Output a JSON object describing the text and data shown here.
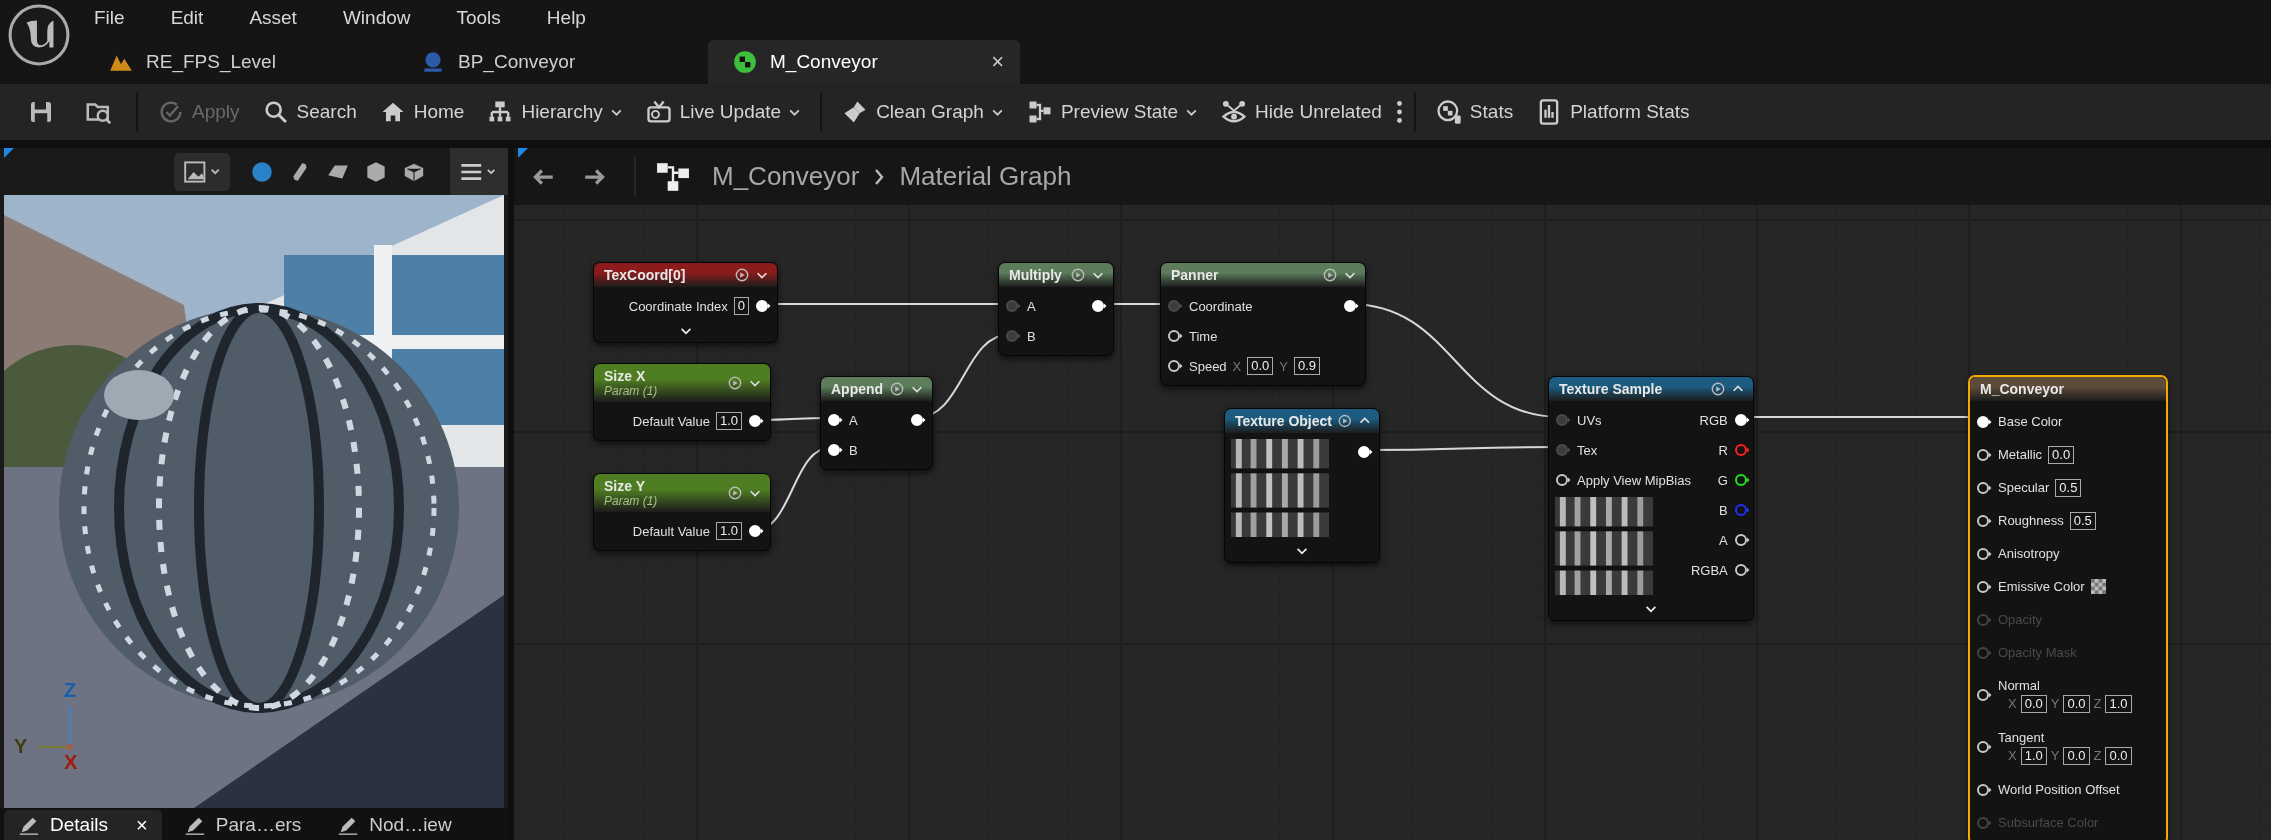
{
  "menu": [
    "File",
    "Edit",
    "Asset",
    "Window",
    "Tools",
    "Help"
  ],
  "document_tabs": [
    {
      "label": "RE_FPS_Level",
      "selected": false
    },
    {
      "label": "BP_Conveyor",
      "selected": false
    },
    {
      "label": "M_Conveyor",
      "selected": true,
      "close": "×"
    }
  ],
  "toolbar": [
    {
      "buttons": [
        {
          "kind": "icon"
        },
        {
          "kind": "icon"
        }
      ]
    },
    {
      "buttons": [
        {
          "kind": "text",
          "label": "Apply",
          "disabled": true,
          "dropdown": false
        },
        {
          "kind": "text",
          "label": "Search",
          "disabled": false,
          "dropdown": false
        },
        {
          "kind": "text",
          "label": "Home",
          "disabled": false,
          "dropdown": false
        },
        {
          "kind": "text",
          "label": "Hierarchy",
          "disabled": false,
          "dropdown": true
        },
        {
          "kind": "text",
          "label": "Live Update",
          "disabled": false,
          "dropdown": true
        }
      ]
    },
    {
      "buttons": [
        {
          "kind": "text",
          "label": "Clean Graph",
          "disabled": false,
          "dropdown": true
        },
        {
          "kind": "text",
          "label": "Preview State",
          "disabled": false,
          "dropdown": true
        },
        {
          "kind": "text",
          "label": "Hide Unrelated",
          "disabled": false,
          "dropdown": false
        },
        {
          "kind": "more"
        }
      ]
    },
    {
      "buttons": [
        {
          "kind": "text",
          "label": "Stats",
          "disabled": false,
          "dropdown": false
        },
        {
          "kind": "text",
          "label": "Platform Stats",
          "disabled": false,
          "dropdown": false
        }
      ]
    }
  ],
  "viewport": {
    "shapes": [
      {
        "selected": true
      },
      {
        "selected": false
      },
      {
        "selected": false
      },
      {
        "selected": false
      },
      {
        "selected": false
      }
    ],
    "axes": [
      "Z",
      "Y",
      "X"
    ]
  },
  "bottom_tabs": [
    {
      "label": "Details",
      "selected": true,
      "close": "×"
    },
    {
      "label": "Para…ers",
      "selected": false
    },
    {
      "label": "Nod…iew",
      "selected": false
    }
  ],
  "graph": {
    "breadcrumb": [
      "M_Conveyor",
      "Material Graph"
    ],
    "nodes": [
      {
        "kind": "expression",
        "title": "TexCoord[0]",
        "color": "#8c1c1c",
        "selected": false,
        "preview": false,
        "advanced_toggle": true,
        "outputs": [
          {
            "label": "Coordinate Index",
            "value": "0",
            "connected": true,
            "highlighted": true
          }
        ]
      },
      {
        "kind": "expression",
        "title": "Size X",
        "subtitle": "Param (1)",
        "color": "#4f7d22",
        "selected": false,
        "preview": false,
        "advanced_toggle": false,
        "outputs": [
          {
            "label": "Default Value",
            "value": "1.0",
            "connected": true,
            "highlighted": true
          }
        ]
      },
      {
        "kind": "expression",
        "title": "Size Y",
        "subtitle": "Param (1)",
        "color": "#4f7d22",
        "selected": false,
        "preview": false,
        "advanced_toggle": false,
        "outputs": [
          {
            "label": "Default Value",
            "value": "1.0",
            "connected": true,
            "highlighted": true
          }
        ]
      },
      {
        "kind": "expression",
        "title": "Append",
        "color": "#5c7c5c",
        "selected": false,
        "preview": false,
        "advanced_toggle": false,
        "inputs": [
          {
            "kind": "pin",
            "label": "A",
            "connected": true,
            "highlighted": true
          },
          {
            "kind": "pin",
            "label": "B",
            "connected": true,
            "highlighted": true
          }
        ],
        "outputs": [
          {
            "connected": true,
            "highlighted": true
          }
        ]
      },
      {
        "kind": "expression",
        "title": "Multiply",
        "color": "#5c7c5c",
        "selected": false,
        "preview": false,
        "advanced_toggle": false,
        "inputs": [
          {
            "kind": "pin",
            "label": "A",
            "connected": true,
            "highlighted": false
          },
          {
            "kind": "pin",
            "label": "B",
            "connected": true,
            "highlighted": false
          }
        ],
        "outputs": [
          {
            "connected": true,
            "highlighted": true
          }
        ]
      },
      {
        "kind": "expression",
        "title": "Panner",
        "color": "#5c7c5c",
        "selected": false,
        "preview": false,
        "advanced_toggle": false,
        "inputs": [
          {
            "kind": "pin",
            "label": "Coordinate",
            "connected": true,
            "highlighted": false
          },
          {
            "kind": "pin",
            "label": "Time",
            "connected": false
          },
          {
            "kind": "pin",
            "label": "Speed",
            "connected": false,
            "values": [
              {
                "axis": "X",
                "value": "0.0"
              },
              {
                "axis": "Y",
                "value": "0.9"
              }
            ]
          }
        ],
        "outputs": [
          {
            "connected": true,
            "highlighted": true
          }
        ]
      },
      {
        "kind": "expression",
        "title": "Texture Object",
        "color": "#1c5c80",
        "selected": false,
        "preview": true,
        "advanced_toggle": true,
        "outputs": [
          {
            "connected": true,
            "highlighted": true
          }
        ]
      },
      {
        "kind": "expression",
        "title": "Texture Sample",
        "color": "#1c5c80",
        "selected": false,
        "preview": true,
        "advanced_toggle": true,
        "inputs": [
          {
            "kind": "pin",
            "label": "UVs",
            "connected": true,
            "highlighted": false
          },
          {
            "kind": "pin",
            "label": "Tex",
            "connected": true,
            "highlighted": false
          },
          {
            "kind": "pin",
            "label": "Apply View MipBias",
            "connected": false
          }
        ],
        "outputs": [
          {
            "label": "RGB",
            "connected": true,
            "highlighted": true,
            "color": "#ffffff"
          },
          {
            "label": "R",
            "connected": false,
            "color": "#ff2020"
          },
          {
            "label": "G",
            "connected": false,
            "color": "#20e020"
          },
          {
            "label": "B",
            "connected": false,
            "color": "#2030ff"
          },
          {
            "label": "A",
            "connected": false,
            "color": "#c8c8c8"
          },
          {
            "label": "RGBA",
            "connected": false,
            "color": "#c8c8c8"
          }
        ]
      },
      {
        "kind": "result",
        "title": "M_Conveyor",
        "color": "#5e4c3a",
        "selected": true,
        "preview": false,
        "advanced_toggle": false,
        "inputs": [
          {
            "kind": "pin",
            "label": "Base Color",
            "connected": true,
            "highlighted": true,
            "disabled": false
          },
          {
            "kind": "pin",
            "label": "Metallic",
            "connected": false,
            "disabled": false,
            "values": [
              {
                "value": "0.0"
              }
            ]
          },
          {
            "kind": "pin",
            "label": "Specular",
            "connected": false,
            "disabled": false,
            "values": [
              {
                "value": "0.5"
              }
            ]
          },
          {
            "kind": "pin",
            "label": "Roughness",
            "connected": false,
            "disabled": false,
            "values": [
              {
                "value": "0.5"
              }
            ]
          },
          {
            "kind": "pin",
            "label": "Anisotropy",
            "connected": false,
            "disabled": false
          },
          {
            "kind": "swatch",
            "label": "Emissive Color",
            "connected": false,
            "disabled": false
          },
          {
            "kind": "pin",
            "label": "Opacity",
            "connected": false,
            "disabled": true
          },
          {
            "kind": "pin",
            "label": "Opacity Mask",
            "connected": false,
            "disabled": true
          },
          {
            "kind": "vector",
            "label": "Normal",
            "connected": false,
            "disabled": false,
            "values": [
              {
                "axis": "X",
                "value": "0.0"
              },
              {
                "axis": "Y",
                "value": "0.0"
              },
              {
                "axis": "Z",
                "value": "1.0"
              }
            ]
          },
          {
            "kind": "vector",
            "label": "Tangent",
            "connected": false,
            "disabled": false,
            "values": [
              {
                "axis": "X",
                "value": "1.0"
              },
              {
                "axis": "Y",
                "value": "0.0"
              },
              {
                "axis": "Z",
                "value": "0.0"
              }
            ]
          },
          {
            "kind": "pin",
            "label": "World Position Offset",
            "connected": false,
            "disabled": false
          },
          {
            "kind": "pin",
            "label": "Subsurface Color",
            "connected": false,
            "disabled": true
          }
        ]
      }
    ]
  }
}
